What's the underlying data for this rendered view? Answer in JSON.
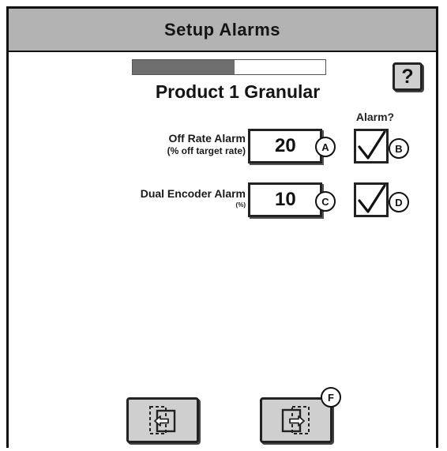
{
  "header": {
    "title": "Setup Alarms"
  },
  "progress": {
    "fraction": 0.53
  },
  "help": {
    "label": "?"
  },
  "product": {
    "title": "Product 1 Granular"
  },
  "alarm_column": {
    "header": "Alarm?"
  },
  "rows": [
    {
      "label": "Off Rate Alarm",
      "sublabel": "(% off target rate)",
      "value": "20",
      "value_callout": "A",
      "checked": true,
      "check_callout": "B"
    },
    {
      "label": "Dual Encoder Alarm",
      "sublabel": "(%)",
      "value": "10",
      "value_callout": "C",
      "checked": true,
      "check_callout": "D"
    }
  ],
  "nav": {
    "back_icon": "exit-arrow-left-icon",
    "next_icon": "enter-arrow-right-icon",
    "next_callout": "F"
  },
  "colors": {
    "title_bar": "#b3b3b3",
    "button_face": "#cfcfcf",
    "progress_fill": "#6e6e6e"
  }
}
